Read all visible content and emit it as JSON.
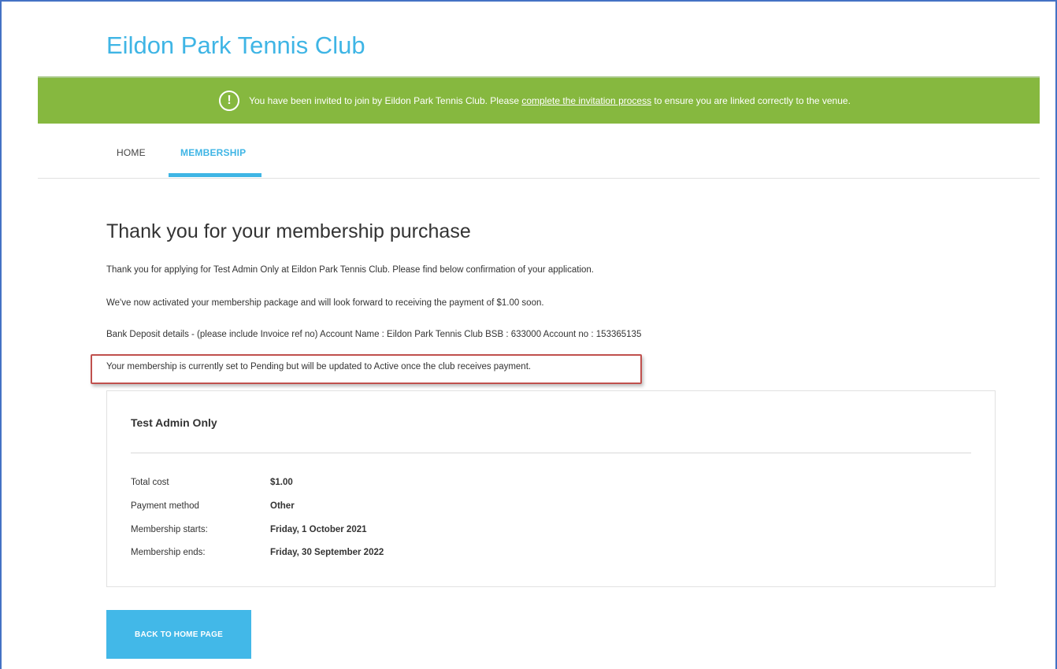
{
  "header": {
    "club_name": "Eildon Park Tennis Club"
  },
  "banner": {
    "icon": "exclamation-circle-icon",
    "text_before": "You have been invited to join by Eildon Park Tennis Club. Please ",
    "link_text": "complete the invitation process",
    "text_after": " to ensure you are linked correctly to the venue."
  },
  "nav": {
    "items": [
      {
        "label": "HOME"
      },
      {
        "label": "MEMBERSHIP"
      }
    ],
    "active": "MEMBERSHIP"
  },
  "main": {
    "heading": "Thank you for your membership purchase",
    "paragraphs": [
      "Thank you for applying for Test Admin Only at Eildon Park Tennis Club. Please find below confirmation of your application.",
      "We've now activated your membership package and will look forward to receiving the payment of $1.00 soon.",
      "Bank Deposit details - (please include Invoice ref no) Account Name : Eildon Park Tennis Club BSB : 633000 Account no : 153365135",
      "Your membership is currently set to Pending but will be updated to Active once the club receives payment."
    ]
  },
  "summary": {
    "title": "Test Admin Only",
    "rows": [
      {
        "label": "Total cost",
        "value": "$1.00"
      },
      {
        "label": "Payment method",
        "value": "Other"
      },
      {
        "label": "Membership starts:",
        "value": "Friday, 1 October 2021"
      },
      {
        "label": "Membership ends:",
        "value": "Friday, 30 September 2022"
      }
    ]
  },
  "actions": {
    "back_label": "BACK TO HOME PAGE"
  },
  "colors": {
    "accent": "#3fb5e5",
    "banner": "#86b83f",
    "highlight": "#c0504d"
  }
}
